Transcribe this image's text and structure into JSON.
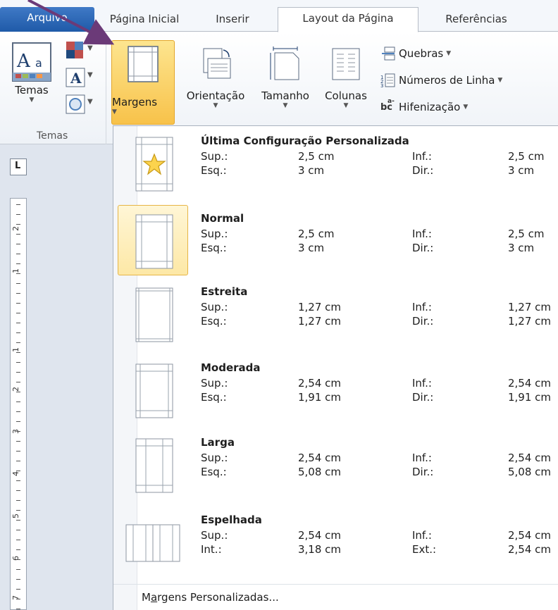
{
  "tabs": [
    {
      "label": "Arquivo"
    },
    {
      "label": "Página Inicial"
    },
    {
      "label": "Inserir"
    },
    {
      "label": "Layout da Página"
    },
    {
      "label": "Referências"
    }
  ],
  "ribbon": {
    "temas": {
      "button_label": "Temas",
      "group_label": "Temas",
      "theme_letter": "A",
      "font_letter": "A"
    },
    "margins_button": "Margens",
    "orientation_button": "Orientação",
    "size_button": "Tamanho",
    "columns_button": "Colunas",
    "breaks": "Quebras",
    "line_numbers": "Números de Linha",
    "hyphenation": "Hifenização",
    "hyphen_icon_text": "bc",
    "hyphen_icon_sup": "a-"
  },
  "ruler": {
    "corner_label": "L",
    "numbers": [
      "2",
      "1",
      "1",
      "2",
      "3",
      "4",
      "5",
      "6",
      "7"
    ]
  },
  "margins_menu": {
    "items": [
      {
        "title": "Última Configuração Personalizada",
        "row1_label": "Sup.:",
        "row1_value": "2,5 cm",
        "row1_label2": "Inf.:",
        "row1_value2": "2,5 cm",
        "row2_label": "Esq.:",
        "row2_value": "3 cm",
        "row2_label2": "Dir.:",
        "row2_value2": "3 cm"
      },
      {
        "title": "Normal",
        "row1_label": "Sup.:",
        "row1_value": "2,5 cm",
        "row1_label2": "Inf.:",
        "row1_value2": "2,5 cm",
        "row2_label": "Esq.:",
        "row2_value": "3 cm",
        "row2_label2": "Dir.:",
        "row2_value2": "3 cm"
      },
      {
        "title": "Estreita",
        "row1_label": "Sup.:",
        "row1_value": "1,27 cm",
        "row1_label2": "Inf.:",
        "row1_value2": "1,27 cm",
        "row2_label": "Esq.:",
        "row2_value": "1,27 cm",
        "row2_label2": "Dir.:",
        "row2_value2": "1,27 cm"
      },
      {
        "title": "Moderada",
        "row1_label": "Sup.:",
        "row1_value": "2,54 cm",
        "row1_label2": "Inf.:",
        "row1_value2": "2,54 cm",
        "row2_label": "Esq.:",
        "row2_value": "1,91 cm",
        "row2_label2": "Dir.:",
        "row2_value2": "1,91 cm"
      },
      {
        "title": "Larga",
        "row1_label": "Sup.:",
        "row1_value": "2,54 cm",
        "row1_label2": "Inf.:",
        "row1_value2": "2,54 cm",
        "row2_label": "Esq.:",
        "row2_value": "5,08 cm",
        "row2_label2": "Dir.:",
        "row2_value2": "5,08 cm"
      },
      {
        "title": "Espelhada",
        "row1_label": "Sup.:",
        "row1_value": "2,54 cm",
        "row1_label2": "Inf.:",
        "row1_value2": "2,54 cm",
        "row2_label": "Int.:",
        "row2_value": "3,18 cm",
        "row2_label2": "Ext.:",
        "row2_value2": "2,54 cm"
      }
    ],
    "footer_pre": "M",
    "footer_underlined": "a",
    "footer_post": "rgens Personalizadas..."
  },
  "colors": {
    "file_tab": "#2a64b3",
    "highlight": "#f8c24a",
    "arrow": "#6b3a78"
  }
}
